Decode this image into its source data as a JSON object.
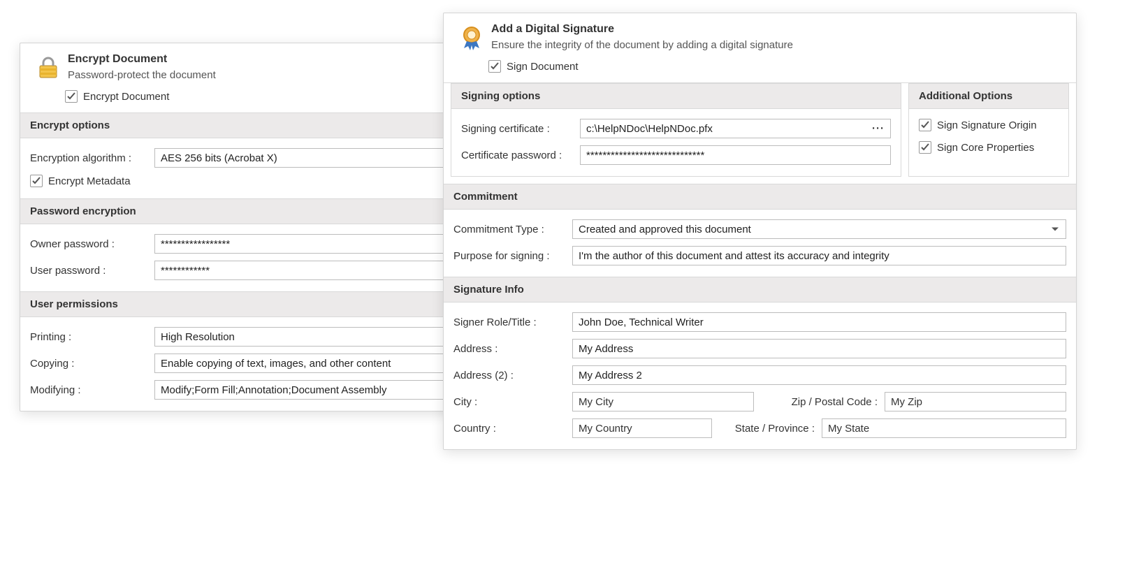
{
  "encrypt": {
    "title": "Encrypt Document",
    "subtitle": "Password-protect the document",
    "toggle_label": "Encrypt Document",
    "options": {
      "header": "Encrypt options",
      "algorithm_label": "Encryption algorithm :",
      "algorithm_value": "AES 256 bits (Acrobat X)",
      "metadata_label": "Encrypt Metadata"
    },
    "password": {
      "header": "Password encryption",
      "owner_label": "Owner password :",
      "owner_value": "*****************",
      "user_label": "User password :",
      "user_value": "************"
    },
    "permissions": {
      "header": "User permissions",
      "printing_label": "Printing :",
      "printing_value": "High Resolution",
      "copying_label": "Copying :",
      "copying_value": "Enable copying of text, images, and other content",
      "modifying_label": "Modifying :",
      "modifying_value": "Modify;Form Fill;Annotation;Document Assembly"
    }
  },
  "sign": {
    "title": "Add a Digital Signature",
    "subtitle": "Ensure the integrity of the document by adding a digital signature",
    "toggle_label": "Sign Document",
    "options": {
      "header": "Signing options",
      "cert_label": "Signing certificate :",
      "cert_value": "c:\\HelpNDoc\\HelpNDoc.pfx",
      "pass_label": "Certificate password :",
      "pass_value": "*****************************"
    },
    "additional": {
      "header": "Additional Options",
      "origin_label": "Sign Signature Origin",
      "core_label": "Sign Core Properties"
    },
    "commitment": {
      "header": "Commitment",
      "type_label": "Commitment Type :",
      "type_value": "Created and approved this document",
      "purpose_label": "Purpose for signing :",
      "purpose_value": "I'm the author of this document and attest its accuracy and integrity"
    },
    "info": {
      "header": "Signature Info",
      "role_label": "Signer Role/Title :",
      "role_value": "John Doe, Technical Writer",
      "addr_label": "Address :",
      "addr_value": "My Address",
      "addr2_label": "Address (2) :",
      "addr2_value": "My Address 2",
      "city_label": "City :",
      "city_value": "My City",
      "zip_label": "Zip / Postal Code :",
      "zip_value": "My Zip",
      "country_label": "Country :",
      "country_value": "My Country",
      "state_label": "State / Province :",
      "state_value": "My State"
    }
  }
}
